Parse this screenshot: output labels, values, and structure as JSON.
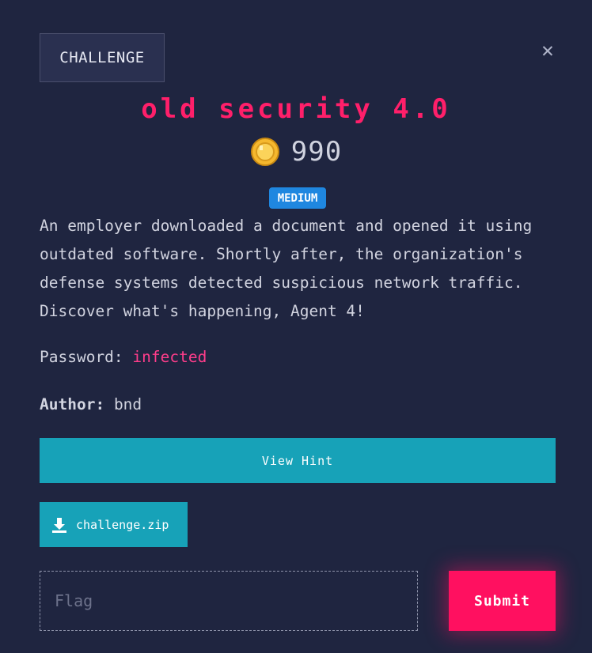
{
  "tab": {
    "label": "CHALLENGE"
  },
  "close": {
    "icon": "close-icon",
    "glyph": "✕"
  },
  "challenge": {
    "title": "old security 4.0",
    "points": "990",
    "difficulty": "MEDIUM",
    "description": "An employer downloaded a document and opened it using outdated software. Shortly after, the organization's defense systems detected suspicious network traffic. Discover what's happening, Agent 4!",
    "password_label": "Password:",
    "password_value": "infected",
    "author_label": "Author:",
    "author_value": "bnd"
  },
  "buttons": {
    "hint": "View Hint",
    "file": "challenge.zip",
    "submit": "Submit"
  },
  "flag": {
    "placeholder": "Flag",
    "value": ""
  },
  "colors": {
    "background": "#1f2540",
    "accent_pink": "#ff1060",
    "button_teal": "#17a2b8",
    "badge_blue": "#1f87e0",
    "coin_gold": "#f5b82e"
  }
}
